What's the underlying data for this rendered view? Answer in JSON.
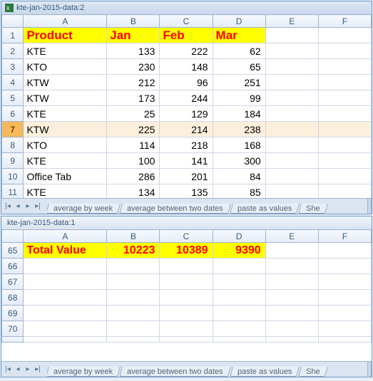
{
  "window_top": {
    "title": "kte-jan-2015-data:2",
    "columns": [
      "A",
      "B",
      "C",
      "D",
      "E",
      "F"
    ],
    "header_row": {
      "num": 1,
      "cells": [
        "Product",
        "Jan",
        "Feb",
        "Mar"
      ]
    },
    "rows": [
      {
        "num": 2,
        "cells": [
          "KTE",
          "133",
          "222",
          "62"
        ]
      },
      {
        "num": 3,
        "cells": [
          "KTO",
          "230",
          "148",
          "65"
        ]
      },
      {
        "num": 4,
        "cells": [
          "KTW",
          "212",
          "96",
          "251"
        ]
      },
      {
        "num": 5,
        "cells": [
          "KTW",
          "173",
          "244",
          "99"
        ]
      },
      {
        "num": 6,
        "cells": [
          "KTE",
          "25",
          "129",
          "184"
        ]
      },
      {
        "num": 7,
        "cells": [
          "KTW",
          "225",
          "214",
          "238"
        ],
        "selected": true
      },
      {
        "num": 8,
        "cells": [
          "KTO",
          "114",
          "218",
          "168"
        ]
      },
      {
        "num": 9,
        "cells": [
          "KTE",
          "100",
          "141",
          "300"
        ]
      },
      {
        "num": 10,
        "cells": [
          "Office Tab",
          "286",
          "201",
          "84"
        ]
      },
      {
        "num": 11,
        "cells": [
          "KTE",
          "134",
          "135",
          "85"
        ]
      }
    ],
    "tabs": [
      "average by week",
      "average between two dates",
      "paste as values",
      "She"
    ]
  },
  "window_bottom": {
    "title": "kte-jan-2015-data:1",
    "columns": [
      "A",
      "B",
      "C",
      "D",
      "E",
      "F"
    ],
    "total_row": {
      "num": 65,
      "cells": [
        "Total Value",
        "10223",
        "10389",
        "9390"
      ]
    },
    "rows": [
      {
        "num": 66
      },
      {
        "num": 67
      },
      {
        "num": 68
      },
      {
        "num": 69
      },
      {
        "num": 70
      }
    ],
    "tabs": [
      "average by week",
      "average between two dates",
      "paste as values",
      "She"
    ]
  },
  "chart_data": [
    {
      "type": "table",
      "title": "kte-jan-2015-data:2 rows 1-11",
      "columns": [
        "Product",
        "Jan",
        "Feb",
        "Mar"
      ],
      "rows": [
        [
          "KTE",
          133,
          222,
          62
        ],
        [
          "KTO",
          230,
          148,
          65
        ],
        [
          "KTW",
          212,
          96,
          251
        ],
        [
          "KTW",
          173,
          244,
          99
        ],
        [
          "KTE",
          25,
          129,
          184
        ],
        [
          "KTW",
          225,
          214,
          238
        ],
        [
          "KTO",
          114,
          218,
          168
        ],
        [
          "KTE",
          100,
          141,
          300
        ],
        [
          "Office Tab",
          286,
          201,
          84
        ],
        [
          "KTE",
          134,
          135,
          85
        ]
      ]
    },
    {
      "type": "table",
      "title": "kte-jan-2015-data:1 row 65",
      "columns": [
        "",
        "Jan",
        "Feb",
        "Mar"
      ],
      "rows": [
        [
          "Total Value",
          10223,
          10389,
          9390
        ]
      ]
    }
  ]
}
